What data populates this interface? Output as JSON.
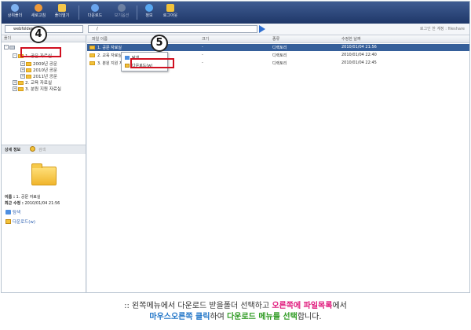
{
  "toolbar": {
    "buttons": [
      {
        "label": "상위폴더",
        "color": "#7fb2f0"
      },
      {
        "label": "새로고침",
        "color": "#f09a3a"
      },
      {
        "label": "폴더열기",
        "color": "#f5c74a"
      },
      {
        "label": "다운로드",
        "color": "#6aa5ee"
      },
      {
        "label": "보기옵션",
        "color": "#9aa6b8"
      },
      {
        "label": "정보",
        "color": "#58a8f2"
      },
      {
        "label": "로그아웃",
        "color": "#f2c23a"
      }
    ]
  },
  "address": {
    "host": "webfolder",
    "path": "/",
    "login_text": "로그인 한 계정 : fileshare"
  },
  "left_panel": {
    "header": "폴더",
    "tree": [
      {
        "label": "1. 공문 자료실",
        "level": 1
      },
      {
        "label": "2009년 공문",
        "level": 2
      },
      {
        "label": "2010년 공문",
        "level": 2
      },
      {
        "label": "2011년 공문",
        "level": 2
      },
      {
        "label": "2. 교육 자료실",
        "level": 1
      },
      {
        "label": "3. 분원 지원 자료실",
        "level": 1
      }
    ]
  },
  "detail": {
    "tab_active": "상세 정보",
    "tab_other": "검색",
    "name_label": "이름 :",
    "name_value": "1. 공문 자료실",
    "modified_label": "최근 수정 :",
    "modified_value": "2010/01/04 21:56",
    "link_explore": "탐색",
    "link_download": "다운로드(w)"
  },
  "file_list": {
    "columns": [
      "파일 이름",
      "크기",
      "종류",
      "수정한 날짜"
    ],
    "rows": [
      {
        "name": "1. 공문 자료실",
        "size": "-",
        "type": "디렉토리",
        "date": "2010/01/04 21:56",
        "selected": true
      },
      {
        "name": "2. 교육 자료실",
        "size": "-",
        "type": "디렉토리",
        "date": "2010/01/04 22:40",
        "selected": false
      },
      {
        "name": "3. 분원 지원 자료실",
        "size": "-",
        "type": "디렉토리",
        "date": "2010/01/04 22:45",
        "selected": false
      }
    ]
  },
  "context_menu": {
    "items": [
      "탐색",
      "다운로드(w)"
    ]
  },
  "callouts": {
    "step4": "4",
    "step5": "5"
  },
  "caption": {
    "line1_a": ":: 왼쪽메뉴에서 다운로드 받을폴더 선택하고 ",
    "line1_b": "오른쪽에 파일목록",
    "line1_c": "에서",
    "line2_a": "마우스오른쪽 클릭",
    "line2_b": "하여 ",
    "line2_c": "다운로드 메뉴를 선택",
    "line2_d": "합니다."
  }
}
